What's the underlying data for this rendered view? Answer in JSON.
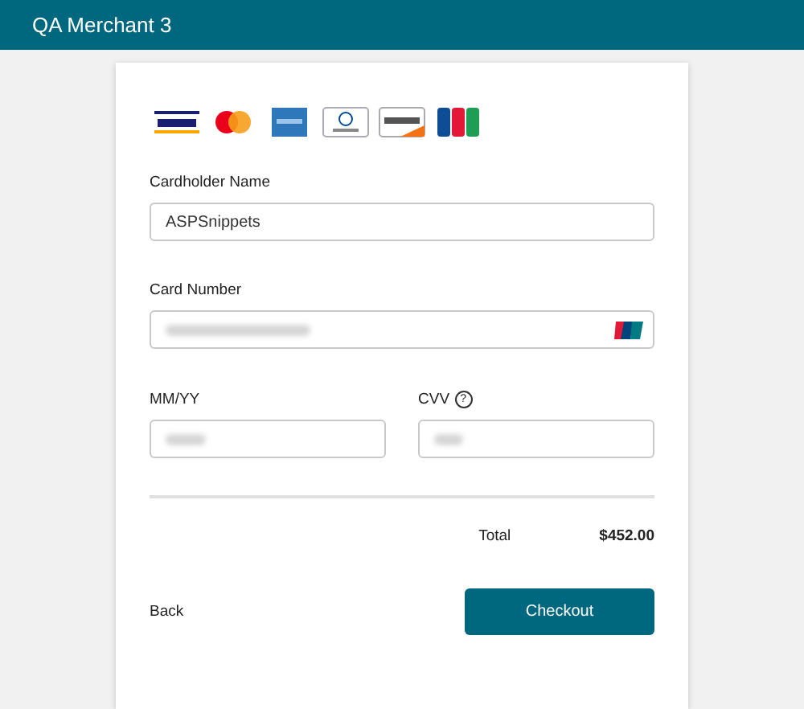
{
  "header": {
    "title": "QA Merchant 3"
  },
  "form": {
    "cardholder": {
      "label": "Cardholder Name",
      "value": "ASPSnippets"
    },
    "card_number": {
      "label": "Card Number"
    },
    "expiry": {
      "label": "MM/YY"
    },
    "cvv": {
      "label": "CVV",
      "help": "?"
    }
  },
  "summary": {
    "label": "Total",
    "amount": "$452.00"
  },
  "actions": {
    "back": "Back",
    "checkout": "Checkout"
  }
}
